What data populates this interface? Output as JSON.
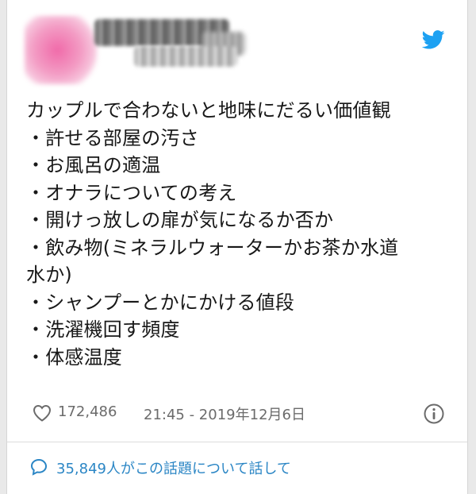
{
  "tweet": {
    "lines": [
      "カップルで合わないと地味にだるい価値観",
      "・許せる部屋の汚さ",
      "・お風呂の適温",
      "・オナラについての考え",
      "・開けっ放しの扉が気になるか否か",
      "・飲み物(ミネラルウォーターかお茶か水道",
      "水か)",
      "・シャンプーとかにかける値段",
      "・洗濯機回す頻度",
      "・体感温度"
    ],
    "likes": "172,486",
    "timestamp": "21:45 - 2019年12月6日",
    "conversation": "35,849人がこの話題について話して"
  },
  "icons": {
    "brand": "twitter-bird-icon",
    "like": "heart-icon",
    "info": "info-icon",
    "reply": "speech-bubble-icon"
  },
  "colors": {
    "twitter_blue": "#1da1f2",
    "link_blue": "#2b86c5",
    "meta_gray": "#6b6b6b"
  }
}
